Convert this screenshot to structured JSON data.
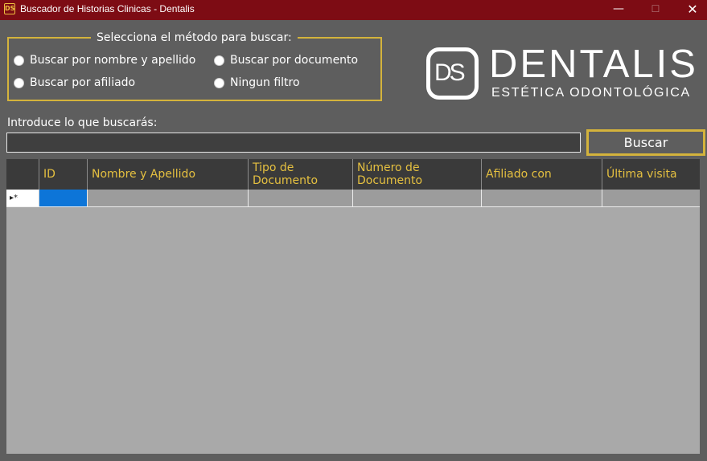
{
  "window": {
    "title": "Buscador de Historias Clinicas - Dentalis",
    "app_icon_text": "DS",
    "minimize_glyph": "—",
    "maximize_glyph": "☐",
    "close_glyph": "✕"
  },
  "filter_group": {
    "legend": "Selecciona el método para buscar:",
    "options": [
      {
        "label": "Buscar por nombre y apellido"
      },
      {
        "label": "Buscar por documento"
      },
      {
        "label": "Buscar por afiliado"
      },
      {
        "label": "Ningun filtro"
      }
    ]
  },
  "logo": {
    "mark": "DS",
    "name": "DENTALIS",
    "tagline": "ESTÉTICA ODONTOLÓGICA"
  },
  "search": {
    "label": "Introduce lo que buscarás:",
    "value": "",
    "button_label": "Buscar"
  },
  "grid": {
    "columns": [
      "ID",
      "Nombre y Apellido",
      "Tipo de Documento",
      "Número de Documento",
      "Afiliado con",
      "Última visita"
    ],
    "new_row_marker": "▸*"
  },
  "colors": {
    "titlebar": "#7d0c14",
    "background": "#5e5e5e",
    "accent": "#d4b33c",
    "header_text": "#e5c040",
    "selection": "#0d75d8"
  }
}
